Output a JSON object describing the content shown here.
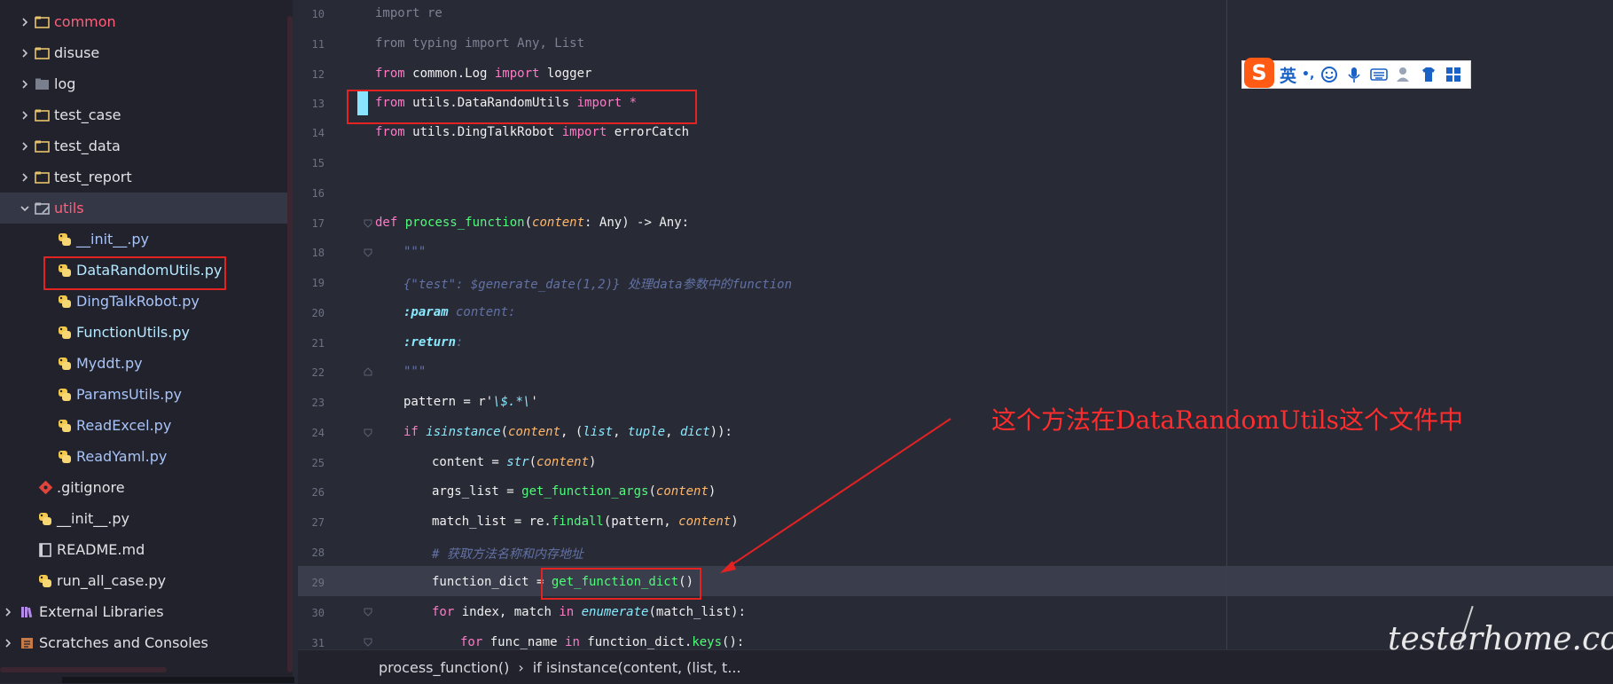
{
  "sidebar": {
    "items": [
      {
        "label": "common",
        "kind": "folder",
        "expanded": false,
        "color": "#ff5f79"
      },
      {
        "label": "disuse",
        "kind": "folder",
        "expanded": false
      },
      {
        "label": "log",
        "kind": "folder",
        "expanded": false
      },
      {
        "label": "test_case",
        "kind": "folder",
        "expanded": false
      },
      {
        "label": "test_data",
        "kind": "folder",
        "expanded": false
      },
      {
        "label": "test_report",
        "kind": "folder",
        "expanded": false
      },
      {
        "label": "utils",
        "kind": "folder",
        "expanded": true,
        "selected": true,
        "color": "#ff5f79"
      },
      {
        "label": "__init__.py",
        "kind": "python"
      },
      {
        "label": "DataRandomUtils.py",
        "kind": "python",
        "boxed": true
      },
      {
        "label": "DingTalkRobot.py",
        "kind": "python"
      },
      {
        "label": "FunctionUtils.py",
        "kind": "python"
      },
      {
        "label": "Myddt.py",
        "kind": "python"
      },
      {
        "label": "ParamsUtils.py",
        "kind": "python"
      },
      {
        "label": "ReadExcel.py",
        "kind": "python"
      },
      {
        "label": "ReadYaml.py",
        "kind": "python"
      },
      {
        "label": ".gitignore",
        "kind": "git"
      },
      {
        "label": "__init__.py",
        "kind": "python"
      },
      {
        "label": "README.md",
        "kind": "markdown"
      },
      {
        "label": "run_all_case.py",
        "kind": "python"
      },
      {
        "label": "External Libraries",
        "kind": "library",
        "expanded": false
      },
      {
        "label": "Scratches and Consoles",
        "kind": "scratches",
        "expanded": false
      }
    ]
  },
  "editor": {
    "line_numbers": [
      "10",
      "11",
      "12",
      "13",
      "14",
      "15",
      "16",
      "17",
      "18",
      "19",
      "20",
      "21",
      "22",
      "23",
      "24",
      "25",
      "26",
      "27",
      "28",
      "29",
      "30",
      "31"
    ],
    "lines": {
      "l10": "import re",
      "l11": "from typing import Any, List",
      "l12": [
        "from",
        " common.Log ",
        "import",
        " logger"
      ],
      "l13": [
        "from",
        " utils.DataRandomUtils ",
        "import",
        " *"
      ],
      "l14": [
        "from",
        " utils.DingTalkRobot ",
        "import",
        " errorCatch"
      ],
      "l17": [
        "def",
        " ",
        "process_function",
        "(",
        "content",
        ": Any) -> Any:"
      ],
      "l18": "\"\"\"",
      "l19": "{\"test\": $generate_date(1,2)} 处理data参数中的function",
      "l20": [
        ":param",
        " content:"
      ],
      "l21": [
        ":return",
        ":"
      ],
      "l22": "\"\"\"",
      "l23": [
        "pattern = r'",
        "\\$.*\\",
        "'"
      ],
      "l24": [
        "if ",
        "isinstance",
        "(",
        "content",
        ", (",
        "list",
        ", ",
        "tuple",
        ", ",
        "dict",
        ")):"
      ],
      "l25": [
        "content = ",
        "str",
        "(",
        "content",
        ")"
      ],
      "l26": [
        "args_list = ",
        "get_function_args",
        "(",
        "content",
        ")"
      ],
      "l27": [
        "match_list = re.",
        "findall",
        "(pattern, ",
        "content",
        ")"
      ],
      "l28": "# 获取方法名称和内存地址",
      "l29": [
        "function_dict = ",
        "get_function_dict",
        "()"
      ],
      "l30": [
        "for",
        " index, match ",
        "in",
        " ",
        "enumerate",
        "(match_list):"
      ],
      "l31": [
        "for",
        " func_name ",
        "in",
        " function_dict.",
        "keys",
        "():"
      ]
    }
  },
  "breadcrumb": {
    "items": [
      "process_function()",
      "if isinstance(content, (list, t..."
    ]
  },
  "annotation": {
    "text": "这个方法在DataRandomUtils这个文件中"
  },
  "ime": {
    "logo": "S",
    "mode": "英",
    "punct": "•,"
  },
  "watermark": "testerhome.com",
  "colors": {
    "background": "#282a36",
    "sidebar": "#21222c",
    "keyword": "#ff79c6",
    "function": "#50fa7b",
    "param": "#ffb86c",
    "builtin": "#8be9fd",
    "comment": "#6272a4",
    "annotation_red": "#ff2d2d",
    "highlight_line": "#3a3d4b"
  }
}
